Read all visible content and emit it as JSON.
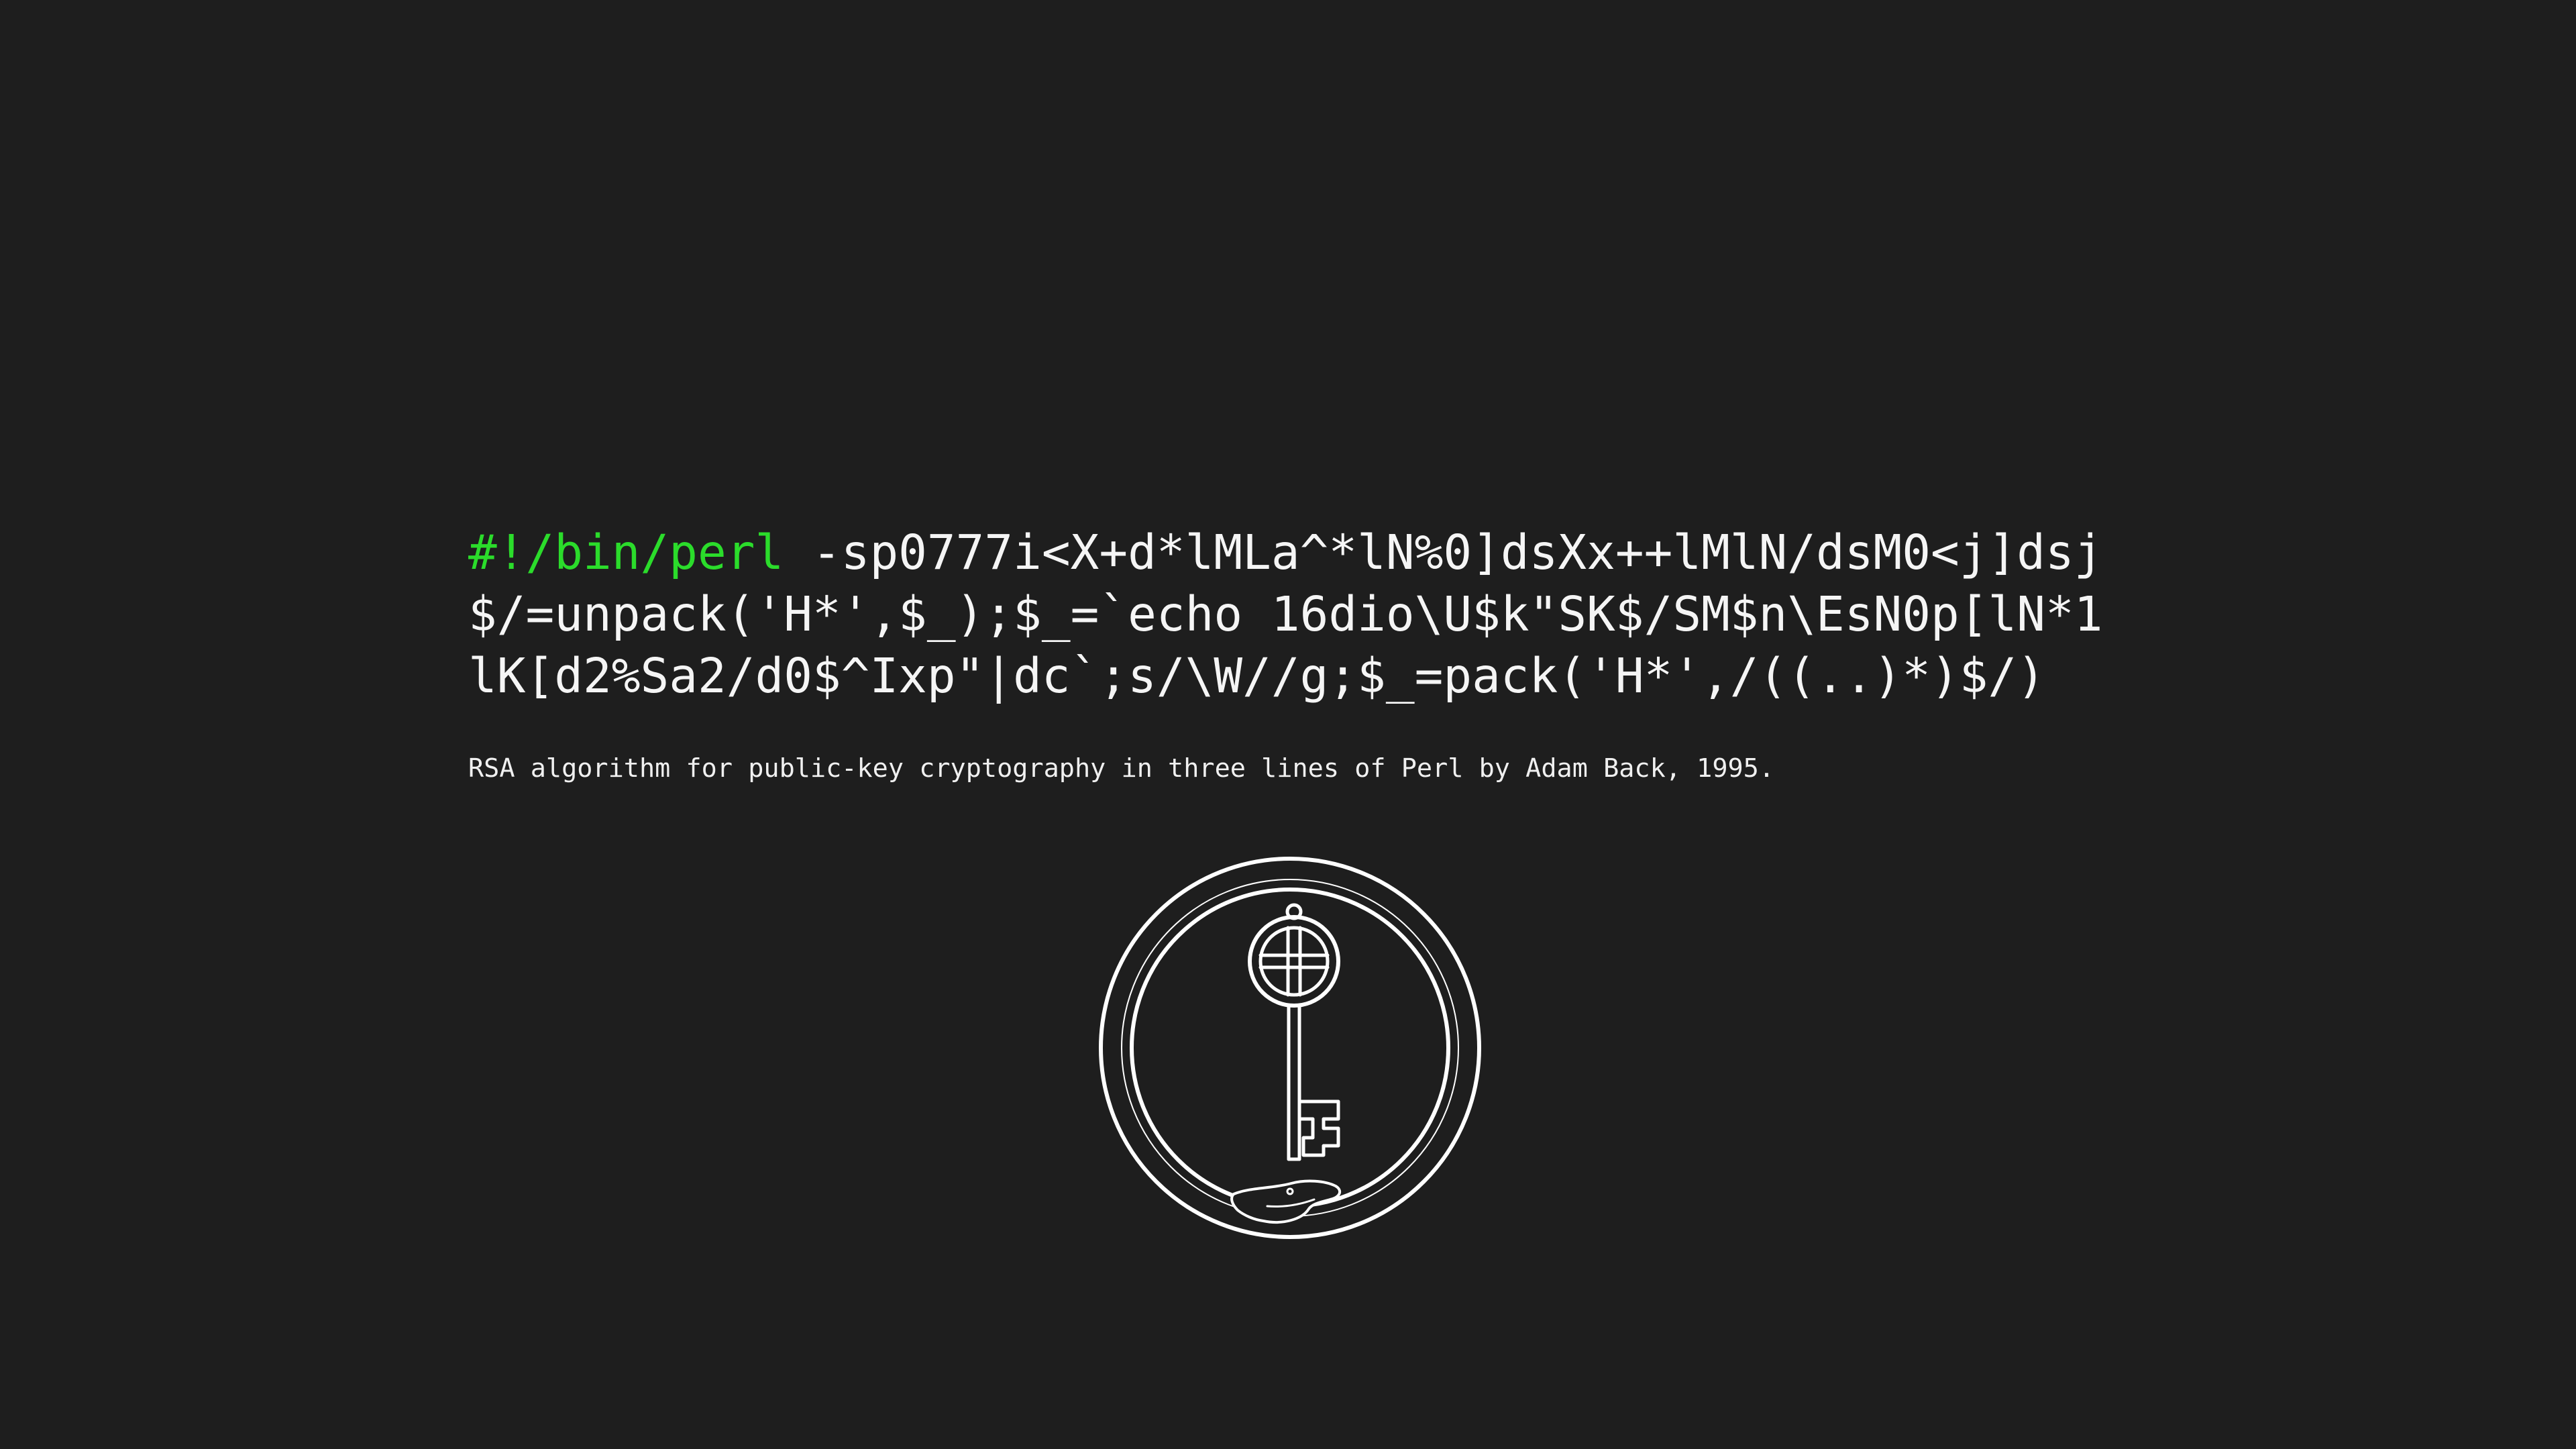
{
  "code": {
    "shebang": "#!/bin/perl",
    "line1_rest": " -sp0777i<X+d*lMLa^*lN%0]dsXx++lMlN/dsM0<j]dsj",
    "line2": "$/=unpack('H*',$_);$_=`echo 16dio\\U$k\"SK$/SM$n\\EsN0p[lN*1",
    "line3": "lK[d2%Sa2/d0$^Ixp\"|dc`;s/\\W//g;$_=pack('H*',/((..)*)$/)"
  },
  "caption": "RSA algorithm for public-key cryptography in three lines of Perl by Adam Back, 1995.",
  "colors": {
    "background": "#1e1e1e",
    "text": "#f5f5f5",
    "shebang": "#2bdc2b"
  },
  "emblem": {
    "icon": "ouroboros-key-icon"
  }
}
